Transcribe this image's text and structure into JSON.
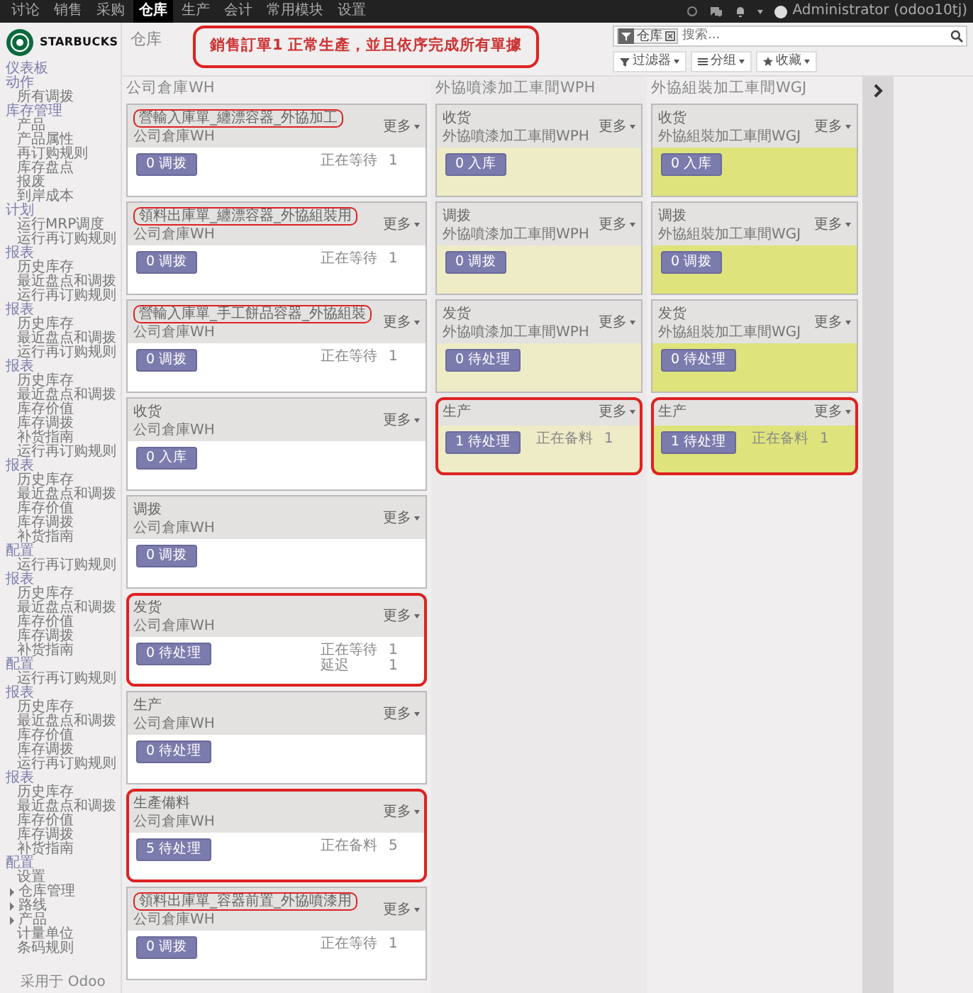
{
  "top_menu": [
    {
      "label": "讨论",
      "selected": false
    },
    {
      "label": "销售",
      "selected": false
    },
    {
      "label": "采购",
      "selected": false
    },
    {
      "label": "仓库",
      "selected": true
    },
    {
      "label": "生产",
      "selected": false
    },
    {
      "label": "会计",
      "selected": false
    },
    {
      "label": "常用模块",
      "selected": false
    },
    {
      "label": "设置",
      "selected": false
    }
  ],
  "user": {
    "name": "Administrator (odoo10tj)"
  },
  "brand": {
    "name": "STARBUCKS"
  },
  "sidebar": {
    "items": [
      {
        "kind": "header",
        "label": "仪表板"
      },
      {
        "kind": "header",
        "label": "动作"
      },
      {
        "kind": "item",
        "label": "所有调拨"
      },
      {
        "kind": "header",
        "label": "库存管理"
      },
      {
        "kind": "item",
        "label": "产品"
      },
      {
        "kind": "item",
        "label": "产品属性"
      },
      {
        "kind": "item",
        "label": "再订购规则"
      },
      {
        "kind": "item",
        "label": "库存盘点"
      },
      {
        "kind": "item",
        "label": "报废"
      },
      {
        "kind": "item",
        "label": "到岸成本"
      },
      {
        "kind": "header",
        "label": "计划"
      },
      {
        "kind": "item",
        "label": "运行MRP调度"
      },
      {
        "kind": "item",
        "label": "运行再订购规则"
      },
      {
        "kind": "header",
        "label": "报表"
      },
      {
        "kind": "item",
        "label": "历史库存"
      },
      {
        "kind": "item",
        "label": "最近盘点和调拨"
      },
      {
        "kind": "item",
        "label": "运行再订购规则"
      },
      {
        "kind": "header",
        "label": "报表"
      },
      {
        "kind": "item",
        "label": "历史库存"
      },
      {
        "kind": "item",
        "label": "最近盘点和调拨"
      },
      {
        "kind": "item",
        "label": "运行再订购规则"
      },
      {
        "kind": "header",
        "label": "报表"
      },
      {
        "kind": "item",
        "label": "历史库存"
      },
      {
        "kind": "item",
        "label": "最近盘点和调拨"
      },
      {
        "kind": "item",
        "label": "库存价值"
      },
      {
        "kind": "item",
        "label": "库存调拨"
      },
      {
        "kind": "item",
        "label": "补货指南"
      },
      {
        "kind": "item",
        "label": "运行再订购规则"
      },
      {
        "kind": "header",
        "label": "报表"
      },
      {
        "kind": "item",
        "label": "历史库存"
      },
      {
        "kind": "item",
        "label": "最近盘点和调拨"
      },
      {
        "kind": "item",
        "label": "库存价值"
      },
      {
        "kind": "item",
        "label": "库存调拨"
      },
      {
        "kind": "item",
        "label": "补货指南"
      },
      {
        "kind": "header",
        "label": "配置"
      },
      {
        "kind": "item",
        "label": "运行再订购规则"
      },
      {
        "kind": "header",
        "label": "报表"
      },
      {
        "kind": "item",
        "label": "历史库存"
      },
      {
        "kind": "item",
        "label": "最近盘点和调拨"
      },
      {
        "kind": "item",
        "label": "库存价值"
      },
      {
        "kind": "item",
        "label": "库存调拨"
      },
      {
        "kind": "item",
        "label": "补货指南"
      },
      {
        "kind": "header",
        "label": "配置"
      },
      {
        "kind": "item",
        "label": "运行再订购规则"
      },
      {
        "kind": "header",
        "label": "报表"
      },
      {
        "kind": "item",
        "label": "历史库存"
      },
      {
        "kind": "item",
        "label": "最近盘点和调拨"
      },
      {
        "kind": "item",
        "label": "库存价值"
      },
      {
        "kind": "item",
        "label": "库存调拨"
      },
      {
        "kind": "item",
        "label": "运行再订购规则"
      },
      {
        "kind": "header",
        "label": "报表"
      },
      {
        "kind": "item",
        "label": "历史库存"
      },
      {
        "kind": "item",
        "label": "最近盘点和调拨"
      },
      {
        "kind": "item",
        "label": "库存价值"
      },
      {
        "kind": "item",
        "label": "库存调拨"
      },
      {
        "kind": "item",
        "label": "补货指南"
      },
      {
        "kind": "header",
        "label": "配置"
      },
      {
        "kind": "item",
        "label": "设置"
      },
      {
        "kind": "folder",
        "label": "仓库管理"
      },
      {
        "kind": "folder",
        "label": "路线"
      },
      {
        "kind": "folder",
        "label": "产品"
      },
      {
        "kind": "item",
        "label": "计量单位"
      },
      {
        "kind": "item",
        "label": "条码规则"
      }
    ],
    "footer": "采用于 Odoo"
  },
  "breadcrumb": "仓库",
  "annotation": "銷售訂單1 正常生產，並且依序完成所有單據",
  "search": {
    "facet": "仓库",
    "placeholder": "搜索..."
  },
  "search_buttons": [
    {
      "kind": "filter",
      "label": "过滤器"
    },
    {
      "kind": "group",
      "label": "分组"
    },
    {
      "kind": "favorite",
      "label": "收藏"
    }
  ],
  "columns": [
    {
      "title": "公司倉庫WH",
      "color": "#ffffff",
      "cards": [
        {
          "title": "營輸入庫單_纏漂容器_外協加工",
          "subtitle": "公司倉庫WH",
          "more": "更多",
          "button": "0 调拨",
          "stats": [
            {
              "label": "正在等待",
              "value": "1"
            }
          ],
          "title_circled": true,
          "card_circled": false
        },
        {
          "title": "領料出庫單_纏漂容器_外協組裝用",
          "subtitle": "公司倉庫WH",
          "more": "更多",
          "button": "0 调拨",
          "stats": [
            {
              "label": "正在等待",
              "value": "1"
            }
          ],
          "title_circled": true,
          "card_circled": false
        },
        {
          "title": "營輸入庫單_手工餅品容器_外協組裝",
          "subtitle": "公司倉庫WH",
          "more": "更多",
          "button": "0 调拨",
          "stats": [
            {
              "label": "正在等待",
              "value": "1"
            }
          ],
          "title_circled": true,
          "card_circled": false
        },
        {
          "title": "收货",
          "subtitle": "公司倉庫WH",
          "more": "更多",
          "button": "0 入库",
          "title_circled": false,
          "card_circled": false
        },
        {
          "title": "调拨",
          "subtitle": "公司倉庫WH",
          "more": "更多",
          "button": "0 调拨",
          "title_circled": false,
          "card_circled": false
        },
        {
          "title": "发货",
          "subtitle": "公司倉庫WH",
          "more": "更多",
          "button": "0 待处理",
          "stats": [
            {
              "label": "正在等待",
              "value": "1"
            },
            {
              "label": "延迟",
              "value": "1"
            }
          ],
          "title_circled": false,
          "card_circled": true
        },
        {
          "title": "生产",
          "subtitle": "公司倉庫WH",
          "more": "更多",
          "button": "0 待处理",
          "title_circled": false,
          "card_circled": false
        },
        {
          "title": "生產備料",
          "subtitle": "公司倉庫WH",
          "more": "更多",
          "button": "5 待处理",
          "stats": [
            {
              "label": "正在备料",
              "value": "5"
            }
          ],
          "title_circled": false,
          "card_circled": true
        },
        {
          "title": "領料出庫單_容器前置_外協噴漆用",
          "subtitle": "公司倉庫WH",
          "more": "更多",
          "button": "0 调拨",
          "stats": [
            {
              "label": "正在等待",
              "value": "1"
            }
          ],
          "title_circled": true,
          "card_circled": false
        }
      ]
    },
    {
      "title": "外協噴漆加工車間WPH",
      "color": "#eeebc7",
      "cards": [
        {
          "title": "收货",
          "subtitle": "外協噴漆加工車間WPH",
          "more": "更多",
          "button": "0 入库",
          "title_circled": false,
          "card_circled": false
        },
        {
          "title": "调拨",
          "subtitle": "外協噴漆加工車間WPH",
          "more": "更多",
          "button": "0 调拨",
          "title_circled": false,
          "card_circled": false
        },
        {
          "title": "发货",
          "subtitle": "外協噴漆加工車間WPH",
          "more": "更多",
          "button": "0 待处理",
          "title_circled": false,
          "card_circled": false
        },
        {
          "title": "生产",
          "more": "更多",
          "button": "1 待处理",
          "stats": [
            {
              "label": "正在备料",
              "value": "1"
            }
          ],
          "title_circled": false,
          "card_circled": true
        }
      ]
    },
    {
      "title": "外協組裝加工車間WGJ",
      "color": "#dee37c",
      "cards": [
        {
          "title": "收货",
          "subtitle": "外協組裝加工車間WGJ",
          "more": "更多",
          "button": "0 入库",
          "title_circled": false,
          "card_circled": false
        },
        {
          "title": "调拨",
          "subtitle": "外協組裝加工車間WGJ",
          "more": "更多",
          "button": "0 调拨",
          "title_circled": false,
          "card_circled": false
        },
        {
          "title": "发货",
          "subtitle": "外協組裝加工車間WGJ",
          "more": "更多",
          "button": "0 待处理",
          "title_circled": false,
          "card_circled": false
        },
        {
          "title": "生产",
          "more": "更多",
          "button": "1 待处理",
          "stats": [
            {
              "label": "正在备料",
              "value": "1"
            }
          ],
          "title_circled": false,
          "card_circled": true
        }
      ]
    }
  ]
}
